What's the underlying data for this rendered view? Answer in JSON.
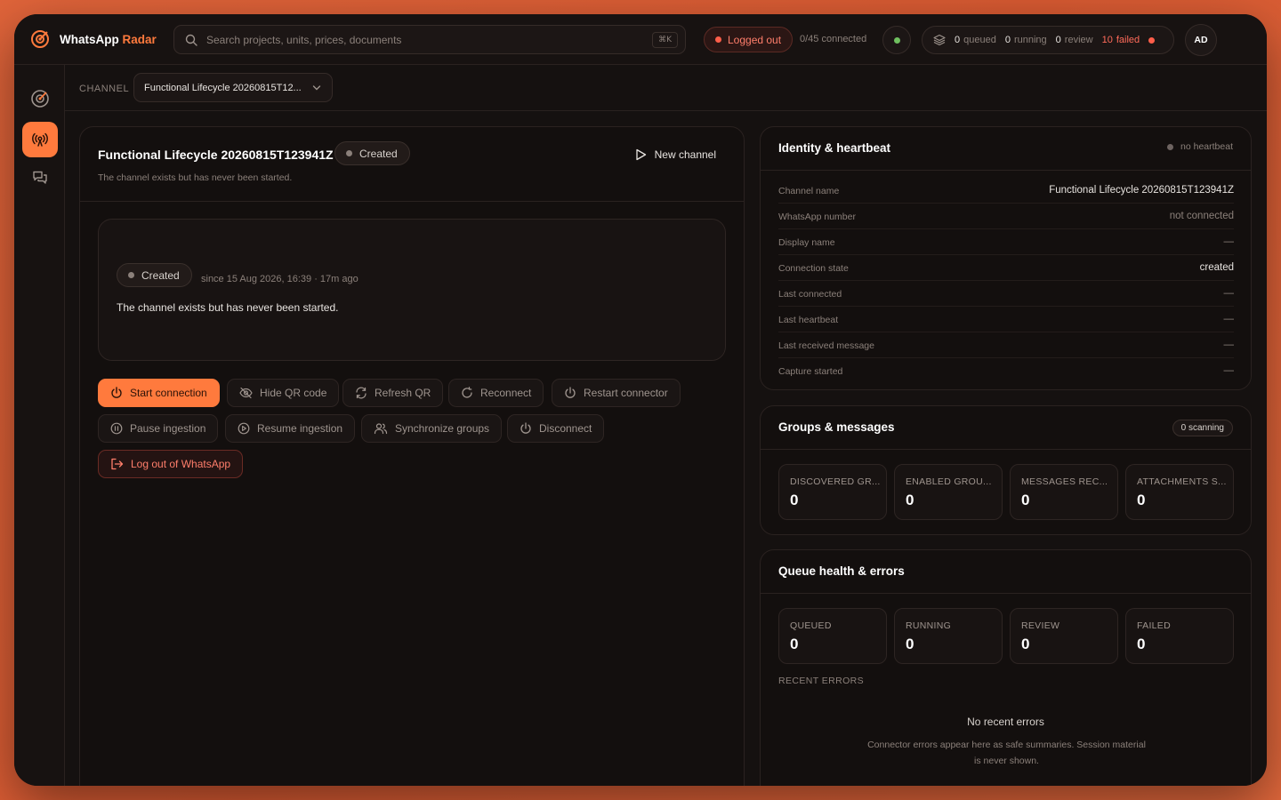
{
  "app": {
    "name_main": "WhatsApp",
    "name_accent": " Radar",
    "accent_color": "#ff7a3d"
  },
  "search": {
    "placeholder": "Search projects, units, prices, documents",
    "shortcut": "⌘K"
  },
  "header": {
    "auth_status": "Logged out",
    "connected_count": "0/45 connected",
    "queue": {
      "queued_n": "0",
      "queued_label": "queued",
      "running_n": "0",
      "running_label": "running",
      "review_n": "0",
      "review_label": "review",
      "failed_n": "10",
      "failed_label": "failed"
    },
    "avatar_initials": "AD"
  },
  "channel_bar": {
    "label": "CHANNEL",
    "selected": "Functional Lifecycle 20260815T12..."
  },
  "main": {
    "title": "Functional Lifecycle 20260815T123941Z",
    "status": "Created",
    "subtitle": "The channel exists but has never been started.",
    "new_channel": "New channel",
    "status_box": {
      "status": "Created",
      "since": "since 15 Aug 2026, 16:39 · 17m ago",
      "description": "The channel exists but has never been started."
    },
    "actions": {
      "start": "Start connection",
      "hide_qr": "Hide QR code",
      "refresh_qr": "Refresh QR",
      "reconnect": "Reconnect",
      "restart": "Restart connector",
      "pause": "Pause ingestion",
      "resume": "Resume ingestion",
      "sync_groups": "Synchronize groups",
      "disconnect": "Disconnect",
      "logout": "Log out of WhatsApp"
    }
  },
  "identity": {
    "title": "Identity & heartbeat",
    "heartbeat_status": "no heartbeat",
    "rows": [
      {
        "key": "Channel name",
        "value": "Functional Lifecycle 20260815T123941Z"
      },
      {
        "key": "WhatsApp number",
        "value": "not connected"
      },
      {
        "key": "Display name",
        "value": "—"
      },
      {
        "key": "Connection state",
        "value": "created"
      },
      {
        "key": "Last connected",
        "value": "—"
      },
      {
        "key": "Last heartbeat",
        "value": "—"
      },
      {
        "key": "Last received message",
        "value": "—"
      },
      {
        "key": "Capture started",
        "value": "—"
      }
    ]
  },
  "groups": {
    "title": "Groups & messages",
    "scanning": "0 scanning",
    "stats": [
      {
        "label": "DISCOVERED GR...",
        "value": "0"
      },
      {
        "label": "ENABLED GROU...",
        "value": "0"
      },
      {
        "label": "MESSAGES REC...",
        "value": "0"
      },
      {
        "label": "ATTACHMENTS S...",
        "value": "0"
      }
    ]
  },
  "queue_health": {
    "title": "Queue health & errors",
    "stats": [
      {
        "label": "QUEUED",
        "value": "0"
      },
      {
        "label": "RUNNING",
        "value": "0"
      },
      {
        "label": "REVIEW",
        "value": "0"
      },
      {
        "label": "FAILED",
        "value": "0"
      }
    ],
    "recent_label": "RECENT ERRORS",
    "empty_title": "No recent errors",
    "empty_sub": "Connector errors appear here as safe summaries. Session material is never shown."
  },
  "icons": {
    "brand": "radar-logo-icon",
    "nav": [
      "radar-logo-icon",
      "broadcast-icon",
      "chat-icon"
    ]
  }
}
